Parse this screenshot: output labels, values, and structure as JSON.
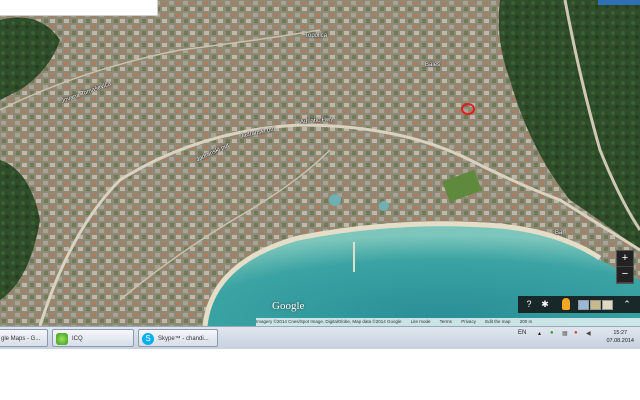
{
  "map": {
    "logo_text": "Google",
    "attribution": [
      "Imagery ©2014 Cnes/Spot Image, DigitalGlobe, Map data ©2014 Google",
      "Lite mode",
      "Terms",
      "Privacy",
      "Edit the map",
      "200 m"
    ],
    "street_labels": [
      "Jadranski put",
      "Adriatic Hwy",
      "Jadranski put",
      "Jovana Tomaševića",
      "Topolica",
      "Baleš",
      "Bar"
    ],
    "zoom_in_label": "+",
    "zoom_out_label": "−",
    "help_label": "?",
    "settings_label": "✱",
    "expand_label": "⌃",
    "marker_color": "#e0201e",
    "colors": {
      "sea": "#2a8f97",
      "shallow": "#63b8b0",
      "forest": "#2f4d2a",
      "urban": "#8e8a77"
    }
  },
  "taskbar": {
    "tasks": [
      {
        "label": "gle Maps - G...",
        "icon": "google-maps-icon"
      },
      {
        "label": "ICQ",
        "icon": "icq-icon"
      },
      {
        "label": "Skype™ - chandi...",
        "icon": "skype-icon"
      }
    ],
    "lang": "EN",
    "time": "15:27",
    "date": "07.08.2014"
  }
}
